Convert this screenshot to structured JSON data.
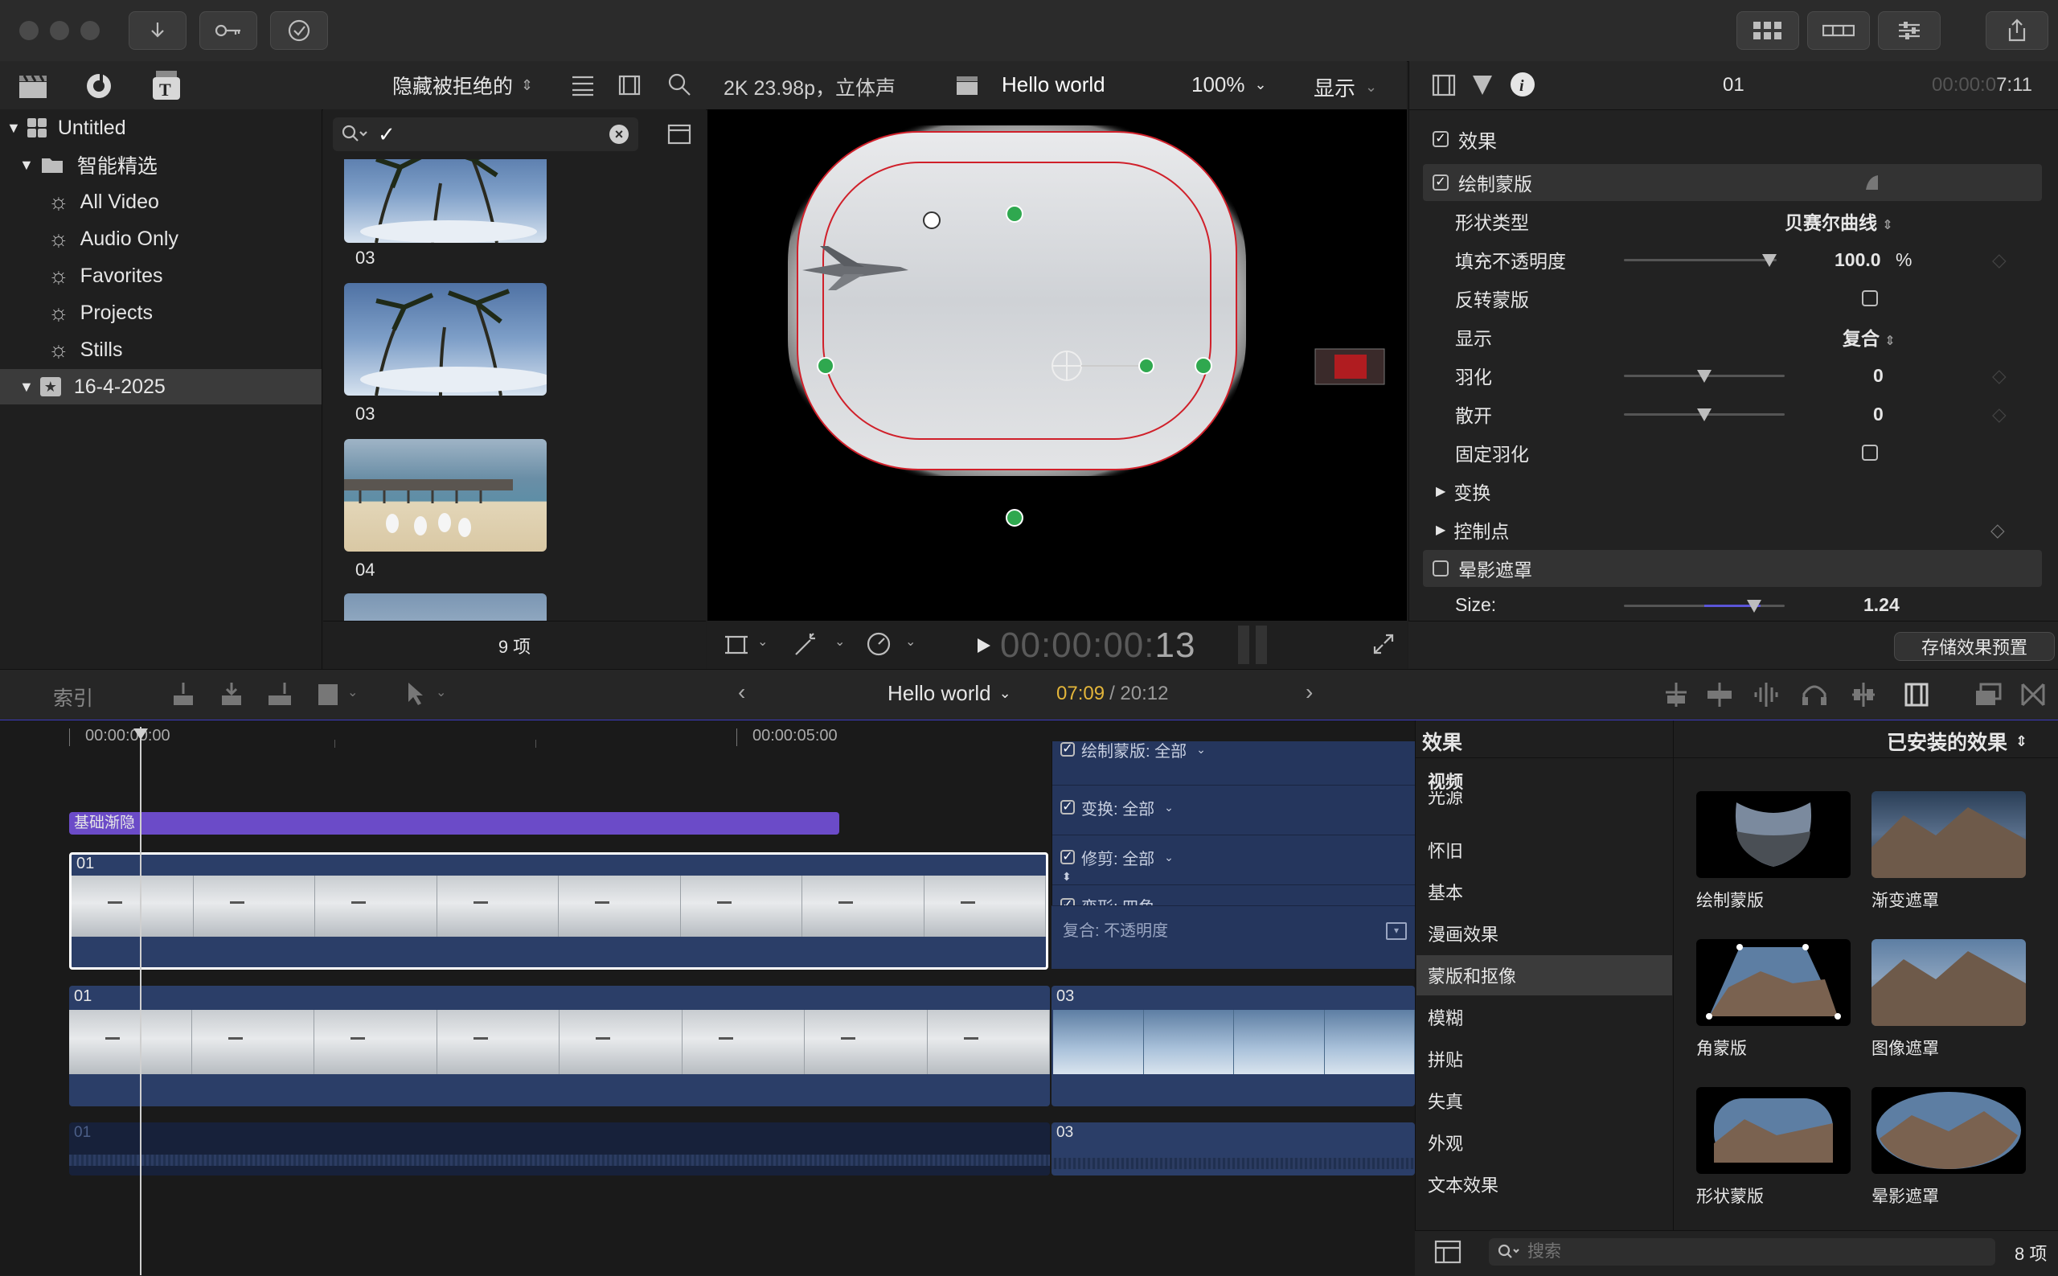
{
  "toolbar": {
    "sort_label": "隐藏被拒绝的",
    "viewer_format": "2K 23.98p，立体声",
    "project_name": "Hello world",
    "zoom": "100%",
    "display_label": "显示"
  },
  "library": {
    "root": "Untitled",
    "smart_collections": "智能精选",
    "items": [
      "All Video",
      "Audio Only",
      "Favorites",
      "Projects",
      "Stills"
    ],
    "event": "16-4-2025"
  },
  "browser": {
    "clips": [
      {
        "label": "03",
        "kind": "palm"
      },
      {
        "label": "03",
        "kind": "palm"
      },
      {
        "label": "04",
        "kind": "beach"
      }
    ],
    "count": "9 项"
  },
  "viewer": {
    "timecode_dim": "00:00:00:",
    "timecode_frames": "13"
  },
  "inspector": {
    "clip_name": "01",
    "timecode_dim": "00:00:0",
    "timecode": "7:11",
    "effects_label": "效果",
    "draw_mask_label": "绘制蒙版",
    "rows": {
      "shape_type_label": "形状类型",
      "shape_type_value": "贝赛尔曲线",
      "fill_opacity_label": "填充不透明度",
      "fill_opacity_value": "100.0",
      "fill_opacity_unit": "%",
      "fill_opacity_level": 0.95,
      "invert_label": "反转蒙版",
      "display_label": "显示",
      "display_value": "复合",
      "feather_label": "羽化",
      "feather_value": "0",
      "feather_level": 0.5,
      "spread_label": "散开",
      "spread_value": "0",
      "spread_level": 0.5,
      "fixed_feather_label": "固定羽化",
      "transform_label": "变换",
      "control_points_label": "控制点",
      "vignette_label": "晕影遮罩",
      "size_label": "Size:",
      "size_value": "1.24",
      "size_level": 0.81
    },
    "save_preset": "存储效果预置"
  },
  "timeline_toolbar": {
    "index_label": "索引",
    "project": "Hello world",
    "time_current": "07:09",
    "time_total": "/ 20:12"
  },
  "timeline": {
    "ruler": [
      "00:00:00:00",
      "00:00:05:00"
    ],
    "transition_label": "基础渐隐",
    "clip_main": "01",
    "clip_lower_a": "01",
    "clip_lower_b": "03",
    "audio_a": "01",
    "audio_b": "03",
    "video_anim": {
      "rows": [
        "绘制蒙版: 全部",
        "变换: 全部",
        "修剪: 全部",
        "变形: 四角",
        "复合: 不透明度"
      ]
    }
  },
  "effects_browser": {
    "title": "效果",
    "installed_label": "已安装的效果",
    "categories": [
      "视频",
      "光源",
      "怀旧",
      "基本",
      "漫画效果",
      "蒙版和抠像",
      "模糊",
      "拼贴",
      "失真",
      "外观",
      "文本效果"
    ],
    "selected_category": "蒙版和抠像",
    "items": [
      "绘制蒙版",
      "渐变遮罩",
      "角蒙版",
      "图像遮罩",
      "形状蒙版",
      "晕影遮罩"
    ],
    "search_placeholder": "搜索",
    "count": "8 项"
  },
  "colors": {
    "accent": "#3d3bbf",
    "clip_blue": "#2b3e68",
    "transition_purple": "#6b4bc8",
    "control_point_green": "#2fa84f",
    "mask_red": "#d0202a",
    "timecode_yellow": "#e3b53a"
  }
}
